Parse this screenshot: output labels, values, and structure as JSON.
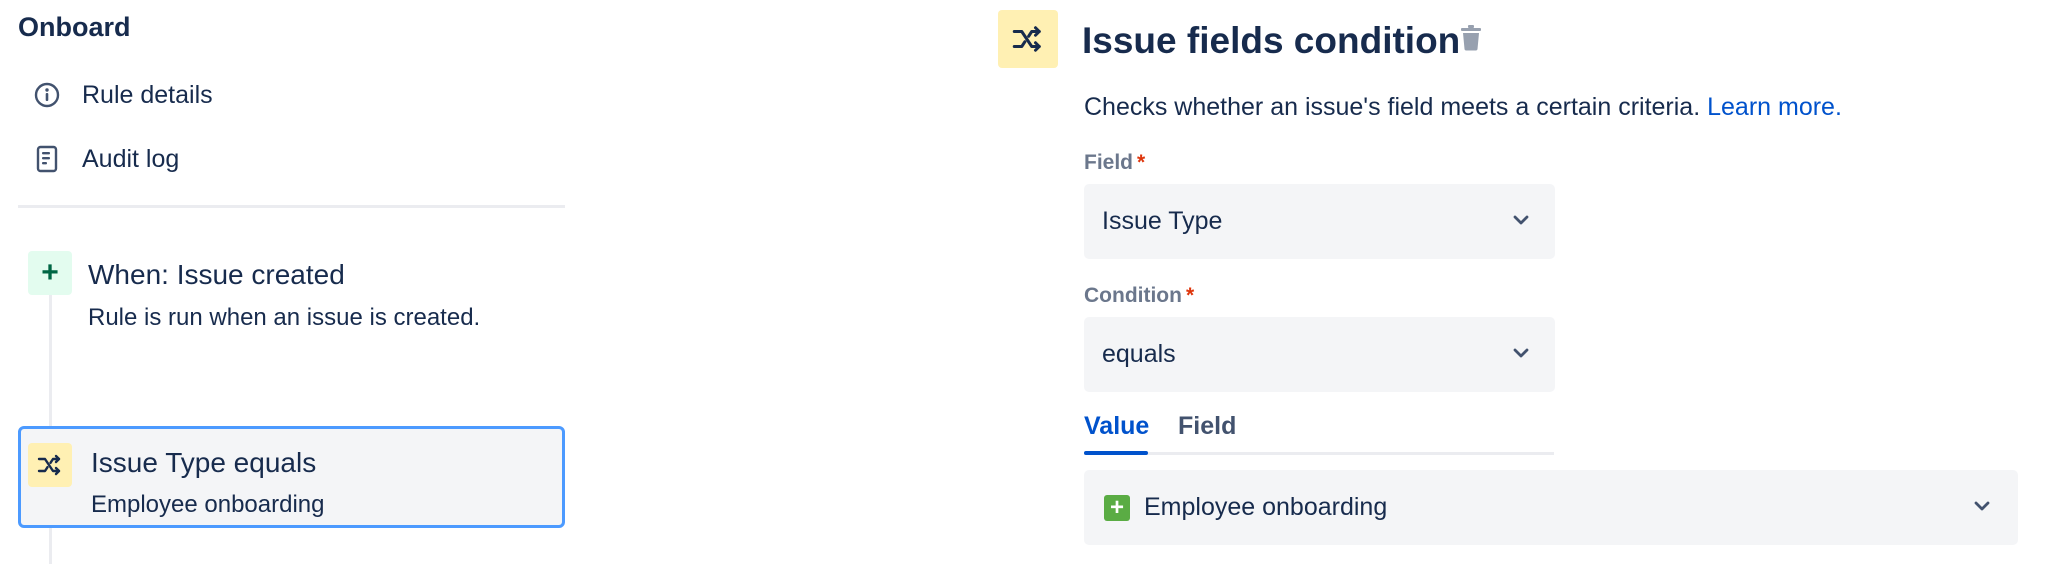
{
  "sidebar": {
    "rule_name": "Onboard",
    "nav": {
      "rule_details": {
        "label": "Rule details",
        "icon": "info-icon"
      },
      "audit_log": {
        "label": "Audit log",
        "icon": "document-icon"
      }
    },
    "steps": {
      "trigger": {
        "title": "When: Issue created",
        "description": "Rule is run when an issue is created.",
        "icon": "plus-icon",
        "icon_glyph": "+"
      },
      "condition": {
        "title": "Issue Type equals",
        "description": "Employee onboarding",
        "icon": "shuffle-icon"
      }
    }
  },
  "panel": {
    "title": "Issue fields condition",
    "description": "Checks whether an issue's field meets a certain criteria.",
    "learn_more": "Learn more.",
    "field": {
      "label": "Field",
      "required_mark": "*",
      "value": "Issue Type"
    },
    "condition": {
      "label": "Condition",
      "required_mark": "*",
      "value": "equals"
    },
    "tabs": {
      "value": "Value",
      "field": "Field",
      "active": "Value"
    },
    "value_select": {
      "value": "Employee onboarding",
      "icon_glyph": "+"
    }
  },
  "colors": {
    "text": "#172b4d",
    "link": "#0052cc",
    "selected_border": "#4c9aff",
    "condition_icon_bg": "#fff0b3",
    "trigger_icon_bg": "#e3fcef",
    "required": "#de350b",
    "issue_type_icon": "#5aac44"
  }
}
